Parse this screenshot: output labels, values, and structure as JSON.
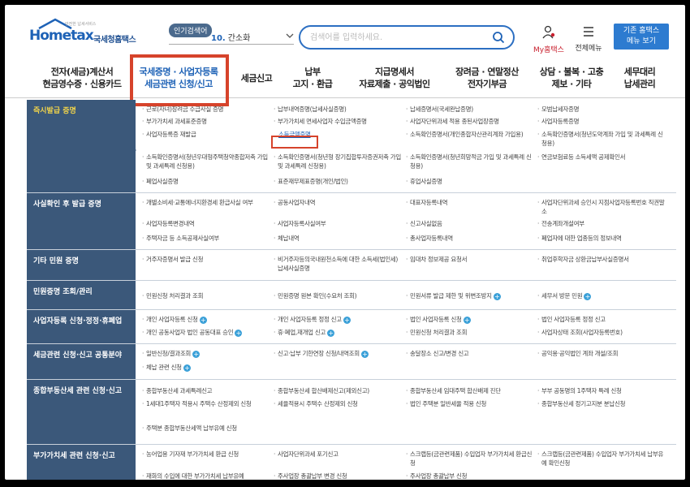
{
  "header": {
    "logo_text": "Hometax",
    "logo_tagline": "안전한 납세서비스",
    "logo_kr": "국세청홈택스",
    "popular_badge": "인기검색어",
    "popular_rank": "10.",
    "popular_term": "간소화",
    "search_placeholder": "검색어를 입력하세요.",
    "my_hometax": "My홈택스",
    "all_menu": "전체메뉴",
    "old_home_line1": "기존 홈택스",
    "old_home_line2": "메뉴 보기"
  },
  "nav": {
    "items": [
      {
        "l1": "전자(세금)계산서",
        "l2": "현금영수증 · 신용카드"
      },
      {
        "l1": "국세증명 · 사업자등록",
        "l2": "세금관련 신청/신고"
      },
      {
        "l1": "세금신고",
        "l2": ""
      },
      {
        "l1": "납부",
        "l2": "고지 · 환급"
      },
      {
        "l1": "지급명세서",
        "l2": "자료제출 · 공익법인"
      },
      {
        "l1": "장려금 · 연말정산",
        "l2": "전자기부금"
      },
      {
        "l1": "상담 · 불복 · 고충",
        "l2": "제보 · 기타"
      },
      {
        "l1": "세무대리",
        "l2": "납세관리"
      }
    ]
  },
  "rows": [
    {
      "head": "즉시발급 증명",
      "cells": [
        "근로(자녀)장려금 수급사실 증명",
        "납부내역증명(납세사실증명)",
        "납세증명서(국세완납증명)",
        "모범납세자증명",
        "부가가치세 과세표준증명",
        "부가가치세 면세사업자 수입금액증명",
        "사업자단위과세 적용 종된사업장증명",
        "사업자등록증명",
        "사업자등록증 재발급",
        "소득금액증명",
        "소득확인증명서(개인종합자산관리계좌 가입용)",
        "소득확인증명서(청년도약계좌 가입 및 과세특례 신청용)",
        "소득확인증명서(청년우대형주택청약종합저축 가입 및 과세특례 신청용)",
        "소득확인증명서(청년형 장기집합투자증권저축 가입 및 과세특례 신청용)",
        "소득확인증명서(청년희망적금 가입 및 과세특례 신청용)",
        "연금보험료등 소득세액 공제확인서",
        "폐업사실증명",
        "표준재무제표증명(개인/법인)",
        "휴업사실증명"
      ]
    },
    {
      "head": "사실확인 후 발급 증명",
      "cells": [
        "개별소비세·교통에너지환경세 환급사실 여부",
        "공동사업자내역",
        "대표자등록내역",
        "사업자단위과세 승인시 지점사업자등록번호 직권말소",
        "사업자등록변경내역",
        "사업자등록사실여부",
        "신고사실없음",
        "전송계좌개설여부",
        "주택자금 등 소득공제사실여부",
        "체납내역",
        "총사업자등록내역",
        "폐업자에 대한 업종등의 정보내역"
      ]
    },
    {
      "head": "기타 민원 증명",
      "cells": [
        "거주자증명서 발급 신청",
        "비거주자등의국내원천소득에 대한 소득세(법인세) 납세사실증명",
        "임대차 정보제공 요청서",
        "취업후학자금 상환금납부사실증명서"
      ]
    },
    {
      "head": "민원증명 조회/관리",
      "cells": [
        "민원신청 처리결과 조회",
        "민원증명 원본 확인(수요처 조회)",
        "민원서류 발급 제한 및 위변조방지",
        "세무서 방문 민원"
      ]
    },
    {
      "head": "사업자등록 신청·정정·휴폐업",
      "cells": [
        "개인 사업자등록 신청",
        "개인 사업자등록 정정 신고",
        "법인 사업자등록 신청",
        "법인 사업자등록 정정 신고",
        "개인 공동사업자 법인 공동대표 승인",
        "휴·폐업,재개업 신고",
        "민원신청 처리결과 조회",
        "사업자상태 조회(사업자등록번호)"
      ]
    },
    {
      "head": "세금관련 신청·신고 공통분야",
      "cells": [
        "일반신청/결과조회",
        "신고·납부 기한연장 신청/내역조회",
        "송달장소 신고/변경 신고",
        "공익용·공익법인 계좌 개설/조회",
        "체납 관련 신청"
      ]
    },
    {
      "head": "종합부동산세 관련 신청·신고",
      "cells": [
        "종합부동산세 과세특례신고",
        "종합부동산세 합산배제신고(제외신고)",
        "종합부동산세 임대주택 합산배제 진단",
        "부부 공동명의 1주택자 특례 신청",
        "1세대1주택자 적용시 주택수 산정제외 신청",
        "세율적용시 주택수 산정제외 신청",
        "법인 주택분 일반세율 적용 신청",
        "종합부동산세 정기고지분 분납신청",
        "주택분 종합부동산세액 납부유예 신청"
      ]
    },
    {
      "head": "부가가치세 관련 신청·신고",
      "cells": [
        "농어업용 기자재 부가가치세 환급 신청",
        "사업자단위과세 포기신고",
        "스크랩등(금관련제품) 수입업자 부가가치세 환급신청",
        "스크랩등(금관련제품) 수입업자 부가가치세 납부유예 확인신청",
        "재화의 수입에 대한 부가가치세 납부유예",
        "주사업장 총괄납부 변경 신청",
        "주사업장 총괄납부 신청"
      ]
    }
  ]
}
